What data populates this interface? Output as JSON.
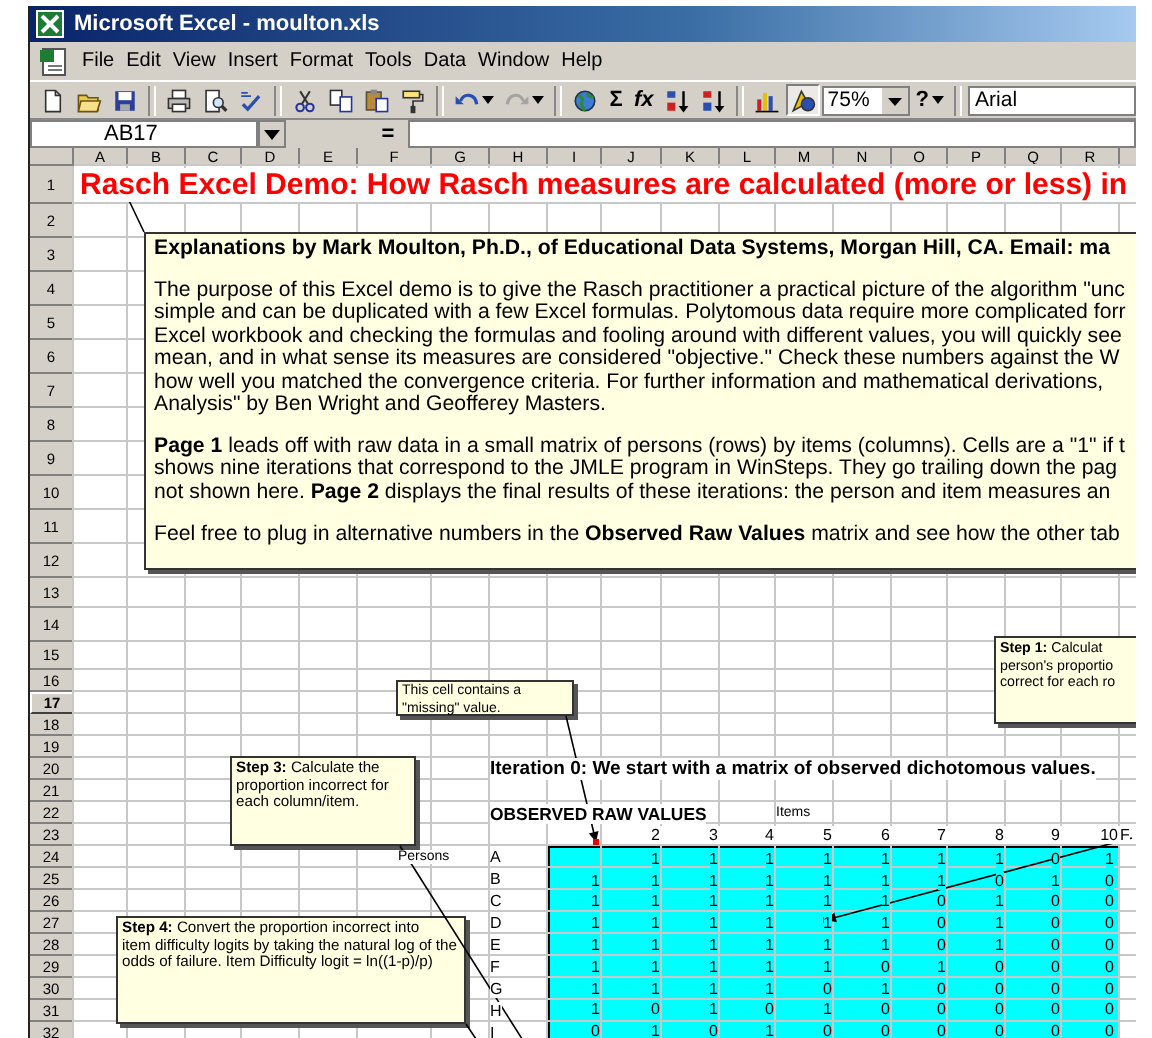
{
  "window": {
    "title": "Microsoft Excel - moulton.xls"
  },
  "menu": [
    "File",
    "Edit",
    "View",
    "Insert",
    "Format",
    "Tools",
    "Data",
    "Window",
    "Help"
  ],
  "toolbar": {
    "buttons": [
      {
        "kind": "new",
        "disabled": false,
        "pressed": false,
        "dropdown": false
      },
      {
        "kind": "open",
        "disabled": false,
        "pressed": false,
        "dropdown": false
      },
      {
        "kind": "save",
        "disabled": false,
        "pressed": false,
        "dropdown": false
      },
      {
        "kind": "separator"
      },
      {
        "kind": "print",
        "disabled": false,
        "pressed": false,
        "dropdown": false
      },
      {
        "kind": "preview",
        "disabled": false,
        "pressed": false,
        "dropdown": false
      },
      {
        "kind": "spelling",
        "disabled": false,
        "pressed": false,
        "dropdown": false
      },
      {
        "kind": "separator"
      },
      {
        "kind": "cut",
        "disabled": false,
        "pressed": false,
        "dropdown": false
      },
      {
        "kind": "copy",
        "disabled": false,
        "pressed": false,
        "dropdown": false
      },
      {
        "kind": "paste",
        "disabled": false,
        "pressed": false,
        "dropdown": false
      },
      {
        "kind": "painter",
        "disabled": false,
        "pressed": false,
        "dropdown": false
      },
      {
        "kind": "separator"
      },
      {
        "kind": "undo",
        "disabled": false,
        "pressed": false,
        "dropdown": true
      },
      {
        "kind": "redo",
        "disabled": true,
        "pressed": false,
        "dropdown": true
      },
      {
        "kind": "separator"
      },
      {
        "kind": "web",
        "disabled": false,
        "pressed": false,
        "dropdown": false
      },
      {
        "kind": "glyph",
        "text": "Σ",
        "disabled": false,
        "pressed": false,
        "dropdown": false
      },
      {
        "kind": "glyph",
        "text": "fx",
        "disabled": false,
        "pressed": false,
        "dropdown": false
      },
      {
        "kind": "sort-asc",
        "disabled": false,
        "pressed": false,
        "dropdown": false
      },
      {
        "kind": "sort-desc",
        "disabled": false,
        "pressed": false,
        "dropdown": false
      },
      {
        "kind": "separator"
      },
      {
        "kind": "chart",
        "disabled": false,
        "pressed": false,
        "dropdown": false
      },
      {
        "kind": "drawing",
        "disabled": false,
        "pressed": true,
        "dropdown": false
      },
      {
        "kind": "zoom",
        "text": "75%"
      },
      {
        "kind": "glyph",
        "text": "?",
        "disabled": false,
        "pressed": false,
        "dropdown": true
      },
      {
        "kind": "separator"
      },
      {
        "kind": "font",
        "text": "Arial"
      }
    ]
  },
  "formula_bar": {
    "name_box": "AB17",
    "equals": "="
  },
  "sheet": {
    "columns": [
      "A",
      "B",
      "C",
      "D",
      "E",
      "F",
      "G",
      "H",
      "I",
      "J",
      "K",
      "L",
      "M",
      "N",
      "O",
      "P",
      "Q",
      "R"
    ],
    "rows": [
      {
        "label": "1",
        "selected": false
      },
      {
        "label": "2",
        "selected": false
      },
      {
        "label": "3",
        "selected": false
      },
      {
        "label": "4",
        "selected": false
      },
      {
        "label": "5",
        "selected": false
      },
      {
        "label": "6",
        "selected": false
      },
      {
        "label": "7",
        "selected": false
      },
      {
        "label": "8",
        "selected": false
      },
      {
        "label": "9",
        "selected": false
      },
      {
        "label": "10",
        "selected": false
      },
      {
        "label": "11",
        "selected": false
      },
      {
        "label": "12",
        "selected": false
      },
      {
        "label": "13",
        "selected": false
      },
      {
        "label": "14",
        "selected": false
      },
      {
        "label": "15",
        "selected": false
      },
      {
        "label": "16",
        "selected": false
      },
      {
        "label": "17",
        "selected": true
      },
      {
        "label": "18",
        "selected": false
      },
      {
        "label": "19",
        "selected": false
      },
      {
        "label": "20",
        "selected": false
      },
      {
        "label": "21",
        "selected": false
      },
      {
        "label": "22",
        "selected": false
      },
      {
        "label": "23",
        "selected": false
      },
      {
        "label": "24",
        "selected": false
      },
      {
        "label": "25",
        "selected": false
      },
      {
        "label": "26",
        "selected": false
      },
      {
        "label": "27",
        "selected": false
      },
      {
        "label": "28",
        "selected": false
      },
      {
        "label": "29",
        "selected": false
      },
      {
        "label": "30",
        "selected": false
      },
      {
        "label": "31",
        "selected": false
      },
      {
        "label": "32",
        "selected": false
      }
    ],
    "title": "Rasch Excel Demo:  How Rasch measures are calculated (more or less) in",
    "iteration_heading": "Iteration 0:  We start with a matrix of observed dichotomous values.",
    "matrix_heading": "OBSERVED RAW VALUES",
    "items_label": "Items",
    "persons_label": "Persons",
    "item_numbers": [
      "2",
      "3",
      "4",
      "5",
      "6",
      "7",
      "8",
      "9",
      "10"
    ],
    "next_column_fragment": "F",
    "persons": [
      {
        "label": "A",
        "values": [
          "1",
          "1",
          "1",
          "1",
          "1",
          "1",
          "1",
          "0",
          "1"
        ]
      },
      {
        "label": "B",
        "values": [
          "1",
          "1",
          "1",
          "1",
          "1",
          "1",
          "1",
          "0",
          "1",
          "0"
        ]
      },
      {
        "label": "C",
        "values": [
          "1",
          "1",
          "1",
          "1",
          "1",
          "1",
          "0",
          "1",
          "0",
          "0"
        ]
      },
      {
        "label": "D",
        "values": [
          "1",
          "1",
          "1",
          "1",
          "1",
          "1",
          "0",
          "1",
          "0",
          "0"
        ]
      },
      {
        "label": "E",
        "values": [
          "1",
          "1",
          "1",
          "1",
          "1",
          "1",
          "0",
          "1",
          "0",
          "0"
        ]
      },
      {
        "label": "F",
        "values": [
          "1",
          "1",
          "1",
          "1",
          "1",
          "0",
          "1",
          "0",
          "0",
          "0"
        ]
      },
      {
        "label": "G",
        "values": [
          "1",
          "1",
          "1",
          "1",
          "0",
          "1",
          "0",
          "0",
          "0",
          "0"
        ]
      },
      {
        "label": "H",
        "values": [
          "1",
          "0",
          "1",
          "0",
          "1",
          "0",
          "0",
          "0",
          "0",
          "0"
        ]
      },
      {
        "label": "I",
        "values": [
          "0",
          "1",
          "0",
          "1",
          "0",
          "0",
          "0",
          "0",
          "0",
          "0"
        ]
      }
    ]
  },
  "text_box": {
    "heading": "Explanations by Mark Moulton, Ph.D., of Educational Data Systems, Morgan Hill, CA.  Email:  ma",
    "paragraphs": [
      [
        "The purpose of this Excel demo is to give the Rasch practitioner a practical picture of the algorithm \"unc",
        "simple and can be duplicated with a few Excel formulas.  Polytomous data require more complicated forr",
        "Excel workbook and checking the formulas and fooling around with different values, you will quickly see",
        "mean, and in what sense its measures are considered \"objective.\"  Check these numbers against the W",
        "how well you matched the convergence criteria.  For further information and  mathematical derivations,",
        "Analysis\" by Ben Wright and Geofferey Masters."
      ],
      [
        "**Page 1** leads off with raw data in a small matrix of persons (rows) by items (columns).  Cells are a \"1\" if t",
        "shows nine iterations that correspond to the JMLE program in WinSteps.  They go trailing down the pag",
        "not shown here.  **Page 2** displays the final results of these iterations:  the person and item measures an"
      ],
      [
        "Feel free to plug in alternative numbers in the **Observed Raw Values** matrix and see how the other tab"
      ]
    ]
  },
  "comments": [
    {
      "lines": [
        "**Step 1:**  Calculat",
        "person's proportio",
        "correct for each ro"
      ]
    },
    {
      "lines": [
        "This cell contains a",
        "\"missing\" value."
      ]
    },
    {
      "lines": [
        "**Step 3:**   Calculate the",
        "proportion incorrect for",
        "each column/item."
      ]
    },
    {
      "lines": [
        "**Step 4:**   Convert the proportion incorrect into",
        "item difficulty logits by taking the natural log of the",
        "odds of failure.  Item Difficulty logit = ln((1-p)/p)"
      ]
    }
  ]
}
